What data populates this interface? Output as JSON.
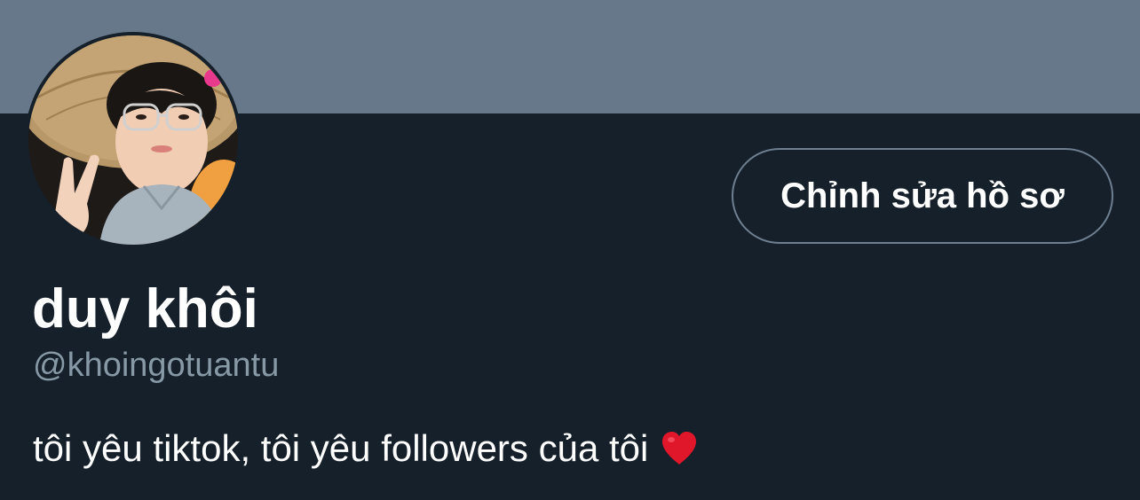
{
  "profile": {
    "display_name": "duy khôi",
    "handle": "@khoingotuantu",
    "bio": "tôi yêu tiktok, tôi yêu followers của tôi",
    "bio_emoji": "heart-icon",
    "edit_button_label": "Chỉnh sửa hồ sơ"
  },
  "colors": {
    "banner": "#66788a",
    "background": "#15202b",
    "handle_text": "#8899a6",
    "button_border": "#6e7f90",
    "heart": "#e0162b"
  }
}
